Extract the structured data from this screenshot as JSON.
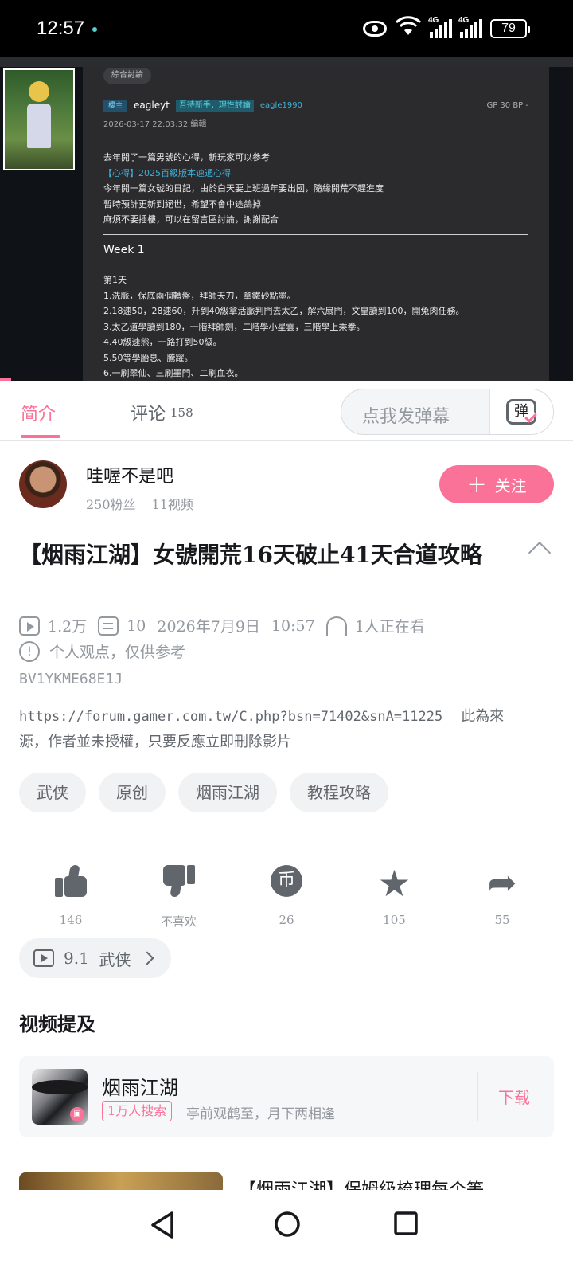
{
  "status_bar": {
    "time": "12:57",
    "network_1": "4G",
    "network_2": "4G",
    "wifi_label": "6",
    "battery": "79"
  },
  "player": {
    "forum_tag": "綜合討論",
    "author_badge": "樓主",
    "author_name": "eagleyt",
    "author_title": "吾待新手．理性討論",
    "author_id": "eagle1990",
    "author_stats": "GP 30    BP -",
    "post_date": "2026-03-17 22:03:32 編輯",
    "body_lines": [
      "去年開了一篇男號的心得，新玩家可以參考",
      "【心得】2025百級版本速通心得",
      "今年開一篇女號的日記，由於白天要上班過年要出國，隨緣開荒不趕進度",
      "暫時預計更新到絕世，希望不會中途鴿掉",
      "麻煩不要插樓，可以在留言區討論，謝謝配合"
    ],
    "week": "Week 1",
    "day": "第1天",
    "day_lines": [
      "1.洗脈，保底兩個轉盤，拜師天刀，拿鐵砂點墨。",
      "2.18速50，28速60，升到40級拿活脈判門去太乙，解六扇門，文皇讀到100，開兔肉任務。",
      "3.太乙道學讀到180，一階拜師劍，二階學小星雲，三階學上乘拳。",
      "4.40級速熊，一路打到50級。",
      "5.50等學胎息、騰躍。",
      "6.一刷翠仙、三刷墨門、二刷血衣。"
    ]
  },
  "tabs": {
    "intro": "简介",
    "comments": "评论",
    "comments_count": "158",
    "danmaku_placeholder": "点我发弹幕",
    "danmaku_icon": "弹"
  },
  "uploader": {
    "name": "哇喔不是吧",
    "fans": "250粉丝",
    "videos": "11视频",
    "follow_label": "关注",
    "follow_icon": "+"
  },
  "video": {
    "title": "【烟雨江湖】女號開荒16天破止41天合道攻略",
    "views": "1.2万",
    "danmaku": "10",
    "date": "2026年7月9日",
    "time": "10:57",
    "watching": "1人正在看",
    "notice": "个人观点，仅供参考",
    "bvid": "BV1YKME68E1J",
    "desc_url": "https://forum.gamer.com.tw/C.php?bsn=71402&snA=11225",
    "desc_text": "此為來源，作者並未授權，只要反應立即刪除影片"
  },
  "tags": [
    "武侠",
    "原创",
    "烟雨江湖",
    "教程攻略"
  ],
  "actions": {
    "like": "146",
    "dislike": "不喜欢",
    "coin": "26",
    "coin_glyph": "币",
    "favorite": "105",
    "share": "55"
  },
  "collection": {
    "score": "9.1",
    "category": "武侠"
  },
  "mentions": {
    "heading": "视频提及",
    "game_name": "烟雨江湖",
    "hot_badge": "1万人搜索",
    "slogan": "亭前观鹤至，月下两相逢",
    "download_label": "下载"
  },
  "next_video": {
    "title": "【烟雨江湖】保姆级梳理每个等"
  },
  "colors": {
    "accent": "#fb7299",
    "text": "#18191c",
    "muted": "#9499a0"
  }
}
